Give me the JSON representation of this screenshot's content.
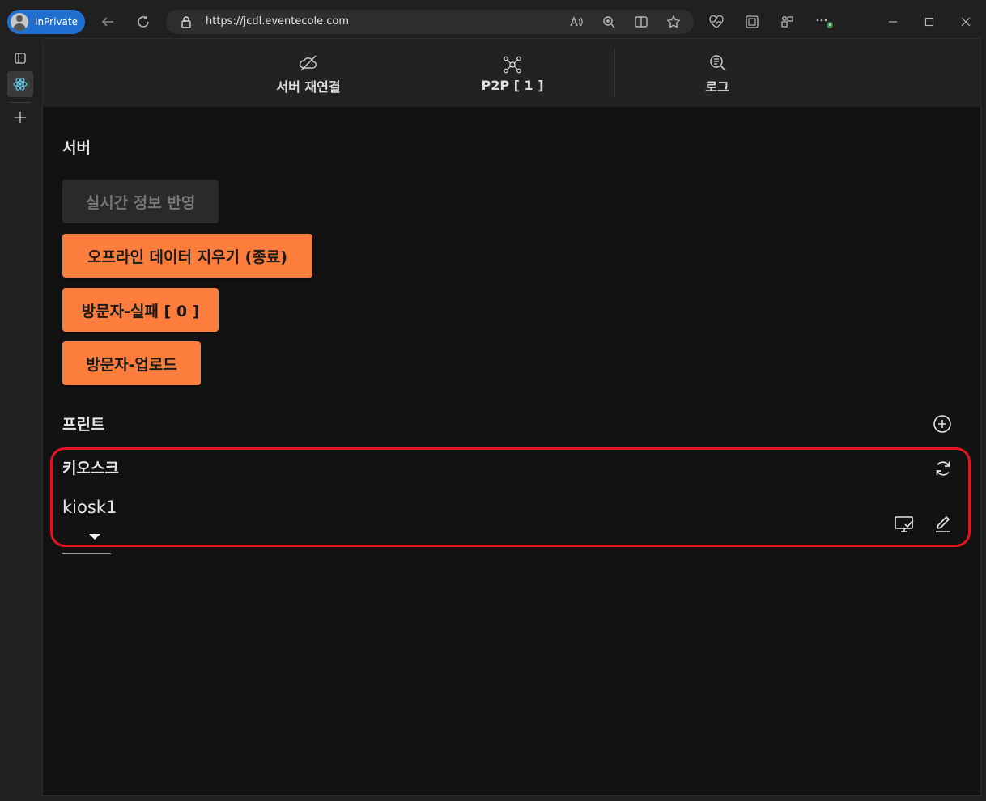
{
  "browser": {
    "profile_label": "InPrivate",
    "url": "https://jcdl.eventecole.com"
  },
  "topnav": {
    "items": [
      {
        "label": "서버 재연결",
        "icon": "cloud-off-icon"
      },
      {
        "label": "P2P [ 1 ]",
        "icon": "network-nodes-icon"
      },
      {
        "label": "로그",
        "icon": "log-search-icon"
      }
    ]
  },
  "server": {
    "title": "서버",
    "buttons": {
      "realtime": "실시간 정보 반영",
      "clear_offline": "오프라인 데이터 지우기 (종료)",
      "visitor_failed": "방문자-실패 [ 0 ]",
      "visitor_upload": "방문자-업로드"
    }
  },
  "print": {
    "title": "프린트"
  },
  "kiosk": {
    "title": "키오스크",
    "selected": "kiosk1"
  },
  "colors": {
    "accent": "#fd7e3c",
    "highlight": "#e3141f",
    "background": "#121212",
    "nav_background": "#222222"
  }
}
